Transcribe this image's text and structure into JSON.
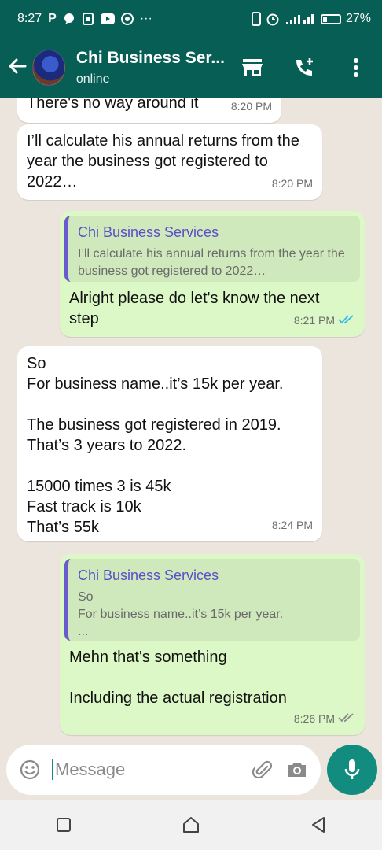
{
  "status_bar": {
    "time": "8:27",
    "app_letter": "P",
    "more": "···",
    "battery_pct": "27%"
  },
  "header": {
    "back_icon": "arrow-left-icon",
    "contact_name": "Chi Business Ser...",
    "status": "online",
    "icons": [
      "storefront-icon",
      "add-call-icon",
      "more-vert-icon"
    ]
  },
  "messages": [
    {
      "dir": "in",
      "text": "There's no way around it",
      "time": "8:20 PM"
    },
    {
      "dir": "in",
      "text": "I’ll calculate his annual returns from the year the business got registered to 2022…",
      "time": "8:20 PM"
    },
    {
      "dir": "out",
      "quote_name": "Chi Business Services",
      "quote_text": "I’ll calculate his annual returns from the year the business got registered to 2022…",
      "text": "Alright please do let's know the next step",
      "time": "8:21 PM"
    },
    {
      "dir": "in",
      "text": "So\nFor business name..it’s 15k per year.\n\nThe business got registered in 2019. That’s 3 years to 2022.\n\n15000 times 3 is 45k\nFast track is 10k\nThat’s 55k",
      "time": "8:24 PM"
    },
    {
      "dir": "out",
      "quote_name": "Chi Business Services",
      "quote_text": "So\nFor business name..it’s 15k per year.\n...",
      "text": "Mehn that's something\n\nIncluding the actual registration",
      "time": "8:26 PM"
    }
  ],
  "composer": {
    "placeholder": "Message"
  },
  "colors": {
    "header": "#075e54",
    "accent": "#128c7e",
    "outgoing": "#dcf8c6",
    "tick_read": "#34b7f1"
  }
}
